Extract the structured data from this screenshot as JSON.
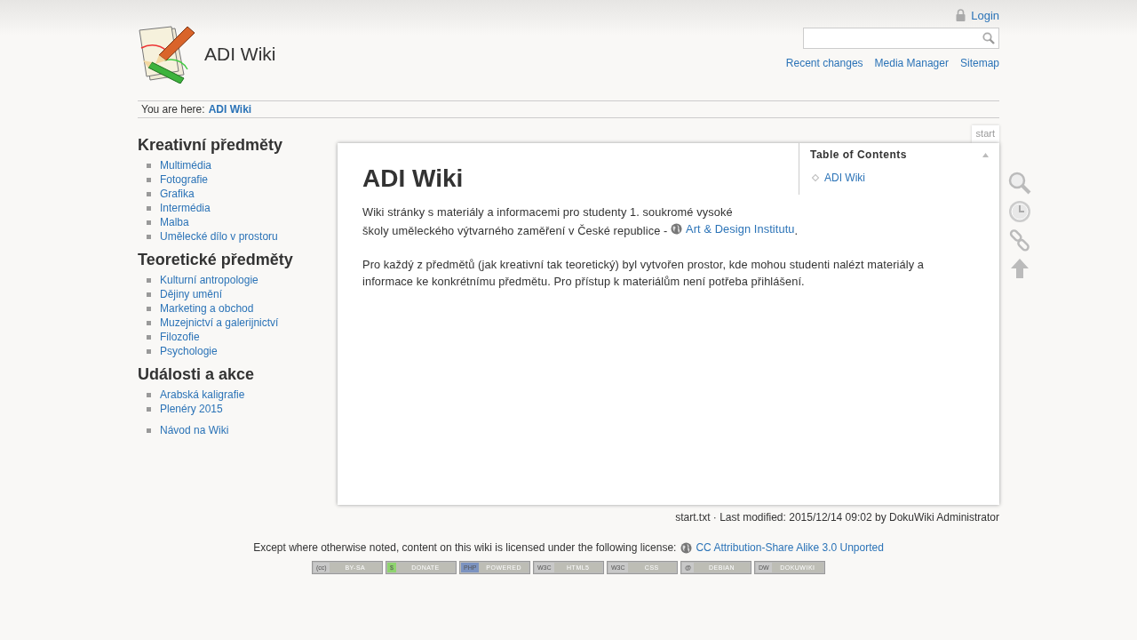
{
  "site": {
    "title": "ADI Wiki"
  },
  "user_tools": [
    {
      "label": "Login"
    }
  ],
  "site_tools": [
    "Recent changes",
    "Media Manager",
    "Sitemap"
  ],
  "breadcrumbs": {
    "label": "You are here:",
    "trail": [
      "ADI Wiki"
    ]
  },
  "sidebar": {
    "sections": [
      {
        "heading": "Kreativní předměty",
        "groups": [
          [
            "Multimédia",
            "Fotografie",
            "Grafika",
            "Intermédia",
            "Malba",
            "Umělecké dílo v prostoru"
          ]
        ]
      },
      {
        "heading": "Teoretické předměty",
        "groups": [
          [
            "Kulturní antropologie",
            "Dějiny umění",
            "Marketing a obchod",
            "Muzejnictví a galerijnictví",
            "Filozofie",
            "Psychologie"
          ]
        ]
      },
      {
        "heading": "Události a akce",
        "groups": [
          [
            "Arabská kaligrafie",
            "Plenéry 2015"
          ],
          [
            "Návod na Wiki"
          ]
        ]
      }
    ]
  },
  "page": {
    "id_tab": "start",
    "heading": "ADI Wiki",
    "paragraph_1": {
      "line_1": "Wiki stránky s materiály a informacemi pro studenty 1. soukromé vysoké",
      "line_2": "školy uměleckého výtvarného zaměření v České republice - ",
      "link": "Art & Design Institutu",
      "end": "."
    },
    "paragraph_2": "Pro každý z předmětů (jak kreativní tak teoretický) byl vytvořen prostor, kde mohou studenti nalézt materiály a informace ke konkrétnímu předmětu. Pro přístup k materiálům není potřeba přihlášení.",
    "toc": {
      "title": "Table of Contents",
      "expanded": true,
      "items": [
        "ADI Wiki"
      ]
    }
  },
  "page_tools": [
    {
      "kind": "search"
    },
    {
      "kind": "revisions"
    },
    {
      "kind": "backlinks"
    },
    {
      "kind": "top"
    }
  ],
  "doc_info": "start.txt · Last modified: 2015/12/14 09:02 by DokuWiki Administrator",
  "license": {
    "text": "Except where otherwise noted, content on this wiki is licensed under the following license:",
    "link": "CC Attribution-Share Alike 3.0 Unported"
  },
  "badges": [
    {
      "left": "(cc)",
      "right": "BY-SA",
      "color": "#c8c8c8"
    },
    {
      "left": "$",
      "right": "DONATE",
      "color": "#8fd36f"
    },
    {
      "left": "PHP",
      "right": "POWERED",
      "color": "#7c93c0"
    },
    {
      "left": "W3C",
      "right": "HTML5",
      "color": "#c8c8c8"
    },
    {
      "left": "W3C",
      "right": "CSS",
      "color": "#c8c8c8"
    },
    {
      "left": "@",
      "right": "DEBIAN",
      "color": "#c8c8c8"
    },
    {
      "left": "DW",
      "right": "DOKUWIKI",
      "color": "#c8c8c8"
    }
  ]
}
